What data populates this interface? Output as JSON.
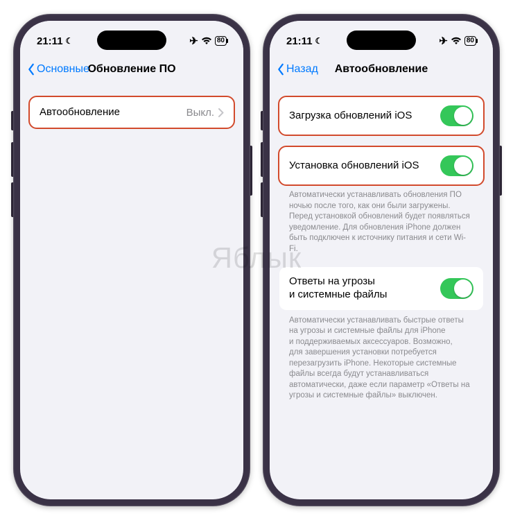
{
  "status": {
    "time": "21:11",
    "battery": "80"
  },
  "left": {
    "back": "Основные",
    "title": "Обновление ПО",
    "row": {
      "label": "Автообновление",
      "value": "Выкл."
    }
  },
  "right": {
    "back": "Назад",
    "title": "Автообновление",
    "row1": {
      "label": "Загрузка обновлений iOS"
    },
    "row2": {
      "label": "Установка обновлений iOS"
    },
    "note1": "Автоматически устанавливать обновления ПО ночью после того, как они были загружены. Перед установкой обновлений будет появляться уведомление. Для обновления iPhone должен быть подключен к источнику питания и сети Wi-Fi.",
    "row3": {
      "label": "Ответы на угрозы и системные файлы"
    },
    "note2": "Автоматически устанавливать быстрые ответы на угрозы и системные файлы для iPhone и поддерживаемых аксессуаров. Возможно, для завершения установки потребуется перезагрузить iPhone. Некоторые системные файлы всегда будут устанавливаться автоматически, даже если параметр «Ответы на угрозы и системные файлы» выключен."
  },
  "watermark": "Яблык"
}
